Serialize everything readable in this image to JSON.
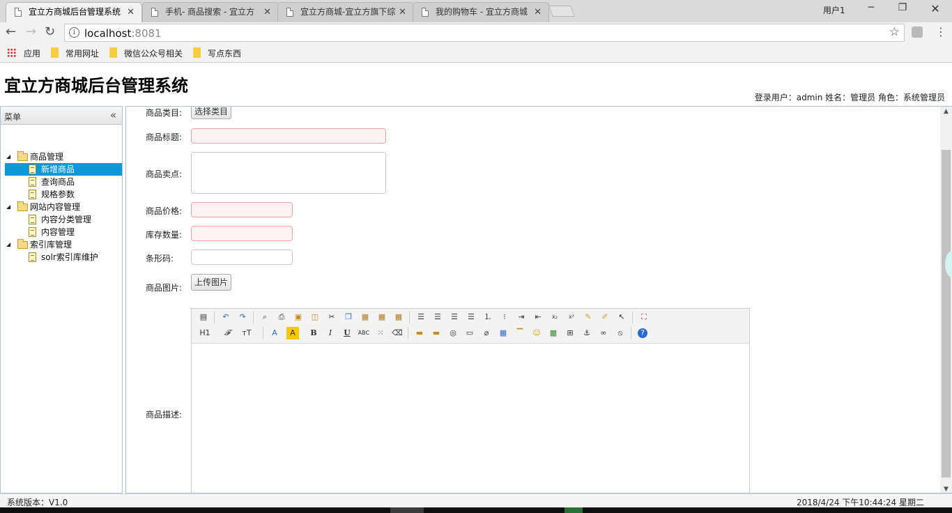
{
  "browser": {
    "tabs": [
      {
        "title": "宜立方商城后台管理系统",
        "active": true
      },
      {
        "title": "手机- 商品搜索 - 宜立方",
        "active": false
      },
      {
        "title": "宜立方商城-宜立方旗下综",
        "active": false
      },
      {
        "title": "我的购物车 - 宜立方商城",
        "active": false
      }
    ],
    "window_user": "用户1",
    "url_host": "localhost",
    "url_port": ":8081",
    "bookmarks": [
      "应用",
      "常用网址",
      "微信公众号相关",
      "写点东西"
    ]
  },
  "app": {
    "title": "宜立方商城后台管理系统",
    "user_info": "登录用户：admin  姓名：管理员  角色：系统管理员"
  },
  "sidebar": {
    "header": "菜单",
    "groups": [
      {
        "label": "商品管理",
        "items": [
          "新增商品",
          "查询商品",
          "规格参数"
        ],
        "selected": 0
      },
      {
        "label": "网站内容管理",
        "items": [
          "内容分类管理",
          "内容管理"
        ]
      },
      {
        "label": "索引库管理",
        "items": [
          "solr索引库维护"
        ]
      }
    ]
  },
  "form": {
    "category_label": "商品类目:",
    "category_button": "选择类目",
    "title_label": "商品标题:",
    "sell_point_label": "商品卖点:",
    "price_label": "商品价格:",
    "stock_label": "库存数量:",
    "barcode_label": "条形码:",
    "image_label": "商品图片:",
    "upload_button": "上传图片",
    "desc_label": "商品描述:"
  },
  "editor": {
    "heading_button": "H1",
    "font_family_button": "𝓕",
    "font_size_button": "тT",
    "font_color_button": "A",
    "bg_color_button": "A",
    "bold": "B",
    "italic": "I",
    "underline": "U",
    "strike": "ABC"
  },
  "status": {
    "version": "系统版本：V1.0",
    "clock": "2018/4/24 下午10:44:24 星期二"
  }
}
